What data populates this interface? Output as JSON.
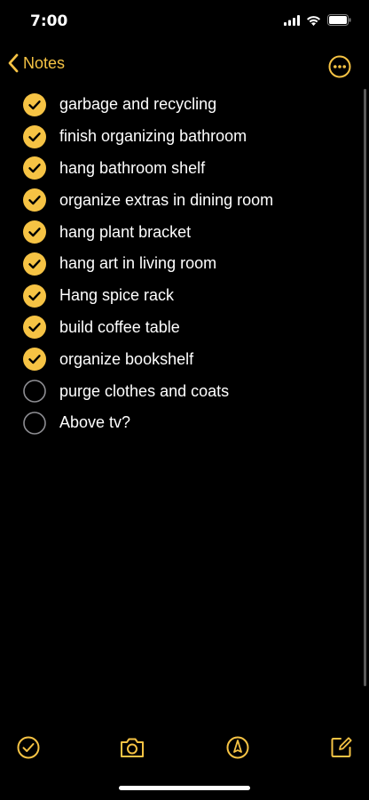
{
  "status": {
    "time": "7:00"
  },
  "nav": {
    "back_label": "Notes"
  },
  "accent": "#f6c344",
  "checklist": [
    {
      "text": "garbage and recycling",
      "checked": true
    },
    {
      "text": "finish organizing bathroom",
      "checked": true
    },
    {
      "text": "hang bathroom shelf",
      "checked": true
    },
    {
      "text": "organize extras in dining room",
      "checked": true
    },
    {
      "text": "hang plant bracket",
      "checked": true
    },
    {
      "text": "hang art in living room",
      "checked": true
    },
    {
      "text": "Hang spice rack",
      "checked": true
    },
    {
      "text": "build coffee table",
      "checked": true
    },
    {
      "text": "organize bookshelf",
      "checked": true
    },
    {
      "text": "purge clothes and coats",
      "checked": false
    },
    {
      "text": "Above tv?",
      "checked": false
    }
  ],
  "toolbar": {
    "icons": [
      "checklist-icon",
      "camera-icon",
      "markup-icon",
      "compose-icon"
    ]
  }
}
